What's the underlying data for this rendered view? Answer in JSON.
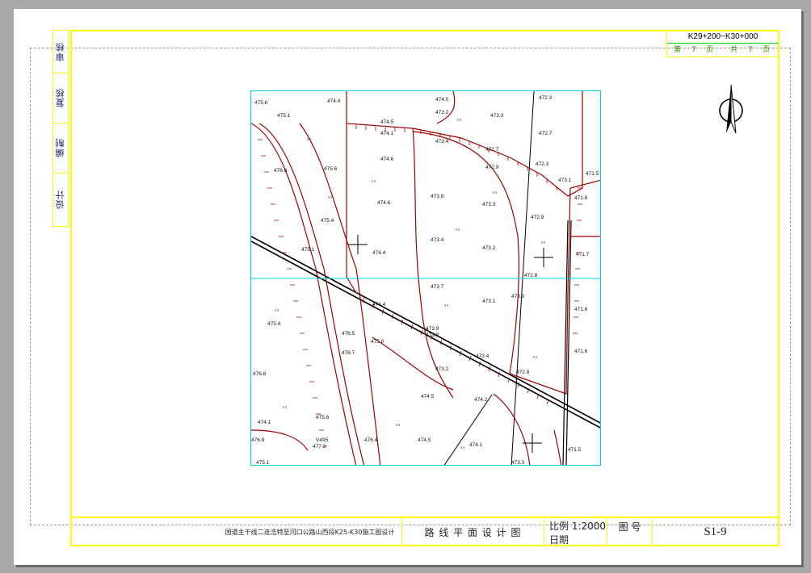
{
  "side_labels": [
    "审核",
    "复核",
    "编制",
    "设计"
  ],
  "page_box": {
    "range": "K29+200~K30+000",
    "page_prefix": "第",
    "page_num": "7",
    "page_unit": "页",
    "total_prefix": "共",
    "total_num": "7",
    "total_unit": "页"
  },
  "title_block": {
    "project": "国道主干线二连浩特至河口公路山西段K25-K30施工图设计",
    "drawing_title": "路 线 平 面 设 计 图",
    "scale": "比例 1:2000",
    "date_label": "日期",
    "drawing_no_label": "图 号",
    "drawing_no": "S1-9"
  },
  "map": {
    "elevations": [
      "475.6",
      "474.4",
      "475.1",
      "474.5",
      "474.0",
      "473.2",
      "473.3",
      "472.3",
      "472.7",
      "474.1",
      "473.4",
      "472.7",
      "472.3",
      "476.8",
      "475.6",
      "474.6",
      "473.1",
      "472.9",
      "474.6",
      "473.8",
      "473.3",
      "471.8",
      "472.9",
      "471.5",
      "475.4",
      "473.4",
      "473.2",
      "471.7",
      "474.4",
      "473.7",
      "473.1",
      "473.0",
      "471.6",
      "475.4",
      "474.4",
      "473.9",
      "476.5",
      "473.9",
      "475.0",
      "476.7",
      "473.4",
      "471.6",
      "476.8",
      "473.2",
      "472.9",
      "474.5",
      "474.2",
      "475.6",
      "474.5",
      "474.1",
      "471.5",
      "473.3",
      "476.4",
      "477.3",
      "476.9",
      "475.1",
      "474.1",
      "472.8",
      "475.1"
    ],
    "survey_label": "V495"
  }
}
